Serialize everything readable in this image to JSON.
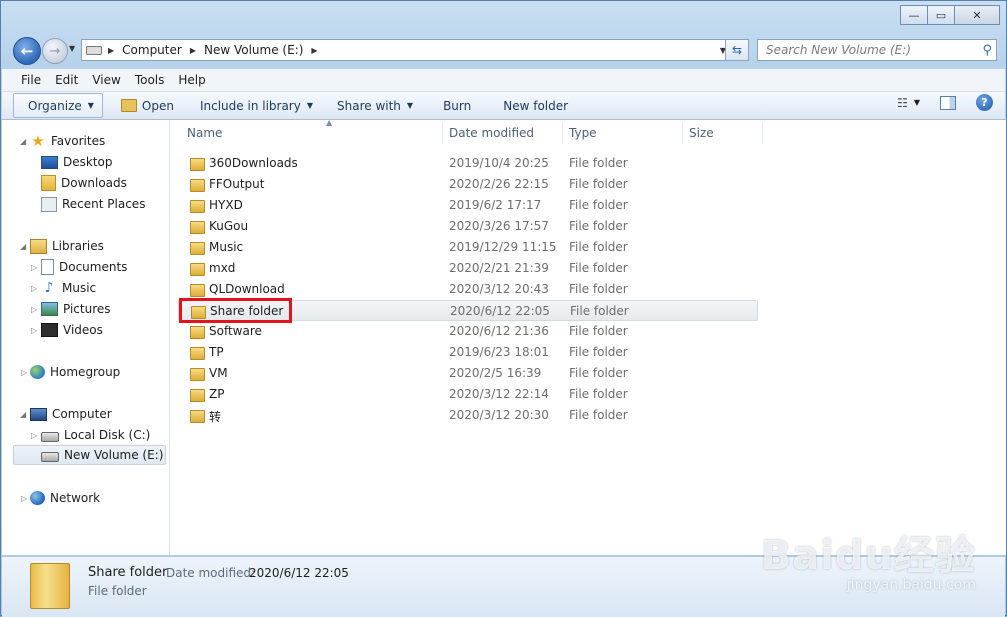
{
  "window": {
    "caption_buttons": [
      "—",
      "▭",
      "✕"
    ]
  },
  "address": {
    "crumbs": [
      "Computer",
      "New Volume (E:)"
    ],
    "search_placeholder": "Search New Volume (E:)"
  },
  "menu": [
    "File",
    "Edit",
    "View",
    "Tools",
    "Help"
  ],
  "toolbar": {
    "organize": "Organize",
    "open": "Open",
    "include_in_library": "Include in library",
    "share_with": "Share with",
    "burn": "Burn",
    "new_folder": "New folder"
  },
  "nav": {
    "favorites": "Favorites",
    "desktop": "Desktop",
    "downloads": "Downloads",
    "recent_places": "Recent Places",
    "libraries": "Libraries",
    "documents": "Documents",
    "music": "Music",
    "pictures": "Pictures",
    "videos": "Videos",
    "homegroup": "Homegroup",
    "computer": "Computer",
    "local_disk": "Local Disk (C:)",
    "new_volume": "New Volume (E:)",
    "network": "Network"
  },
  "columns": {
    "name": "Name",
    "date_modified": "Date modified",
    "type": "Type",
    "size": "Size"
  },
  "files": [
    {
      "name": "360Downloads",
      "date": "2019/10/4 20:25",
      "type": "File folder"
    },
    {
      "name": "FFOutput",
      "date": "2020/2/26 22:15",
      "type": "File folder"
    },
    {
      "name": "HYXD",
      "date": "2019/6/2 17:17",
      "type": "File folder"
    },
    {
      "name": "KuGou",
      "date": "2020/3/26 17:57",
      "type": "File folder"
    },
    {
      "name": "Music",
      "date": "2019/12/29 11:15",
      "type": "File folder"
    },
    {
      "name": "mxd",
      "date": "2020/2/21 21:39",
      "type": "File folder"
    },
    {
      "name": "QLDownload",
      "date": "2020/3/12 20:43",
      "type": "File folder"
    },
    {
      "name": "Share folder",
      "date": "2020/6/12 22:05",
      "type": "File folder",
      "selected": true
    },
    {
      "name": "Software",
      "date": "2020/6/12 21:36",
      "type": "File folder"
    },
    {
      "name": "TP",
      "date": "2019/6/23 18:01",
      "type": "File folder"
    },
    {
      "name": "VM",
      "date": "2020/2/5 16:39",
      "type": "File folder"
    },
    {
      "name": "ZP",
      "date": "2020/3/12 22:14",
      "type": "File folder"
    },
    {
      "name": "转",
      "date": "2020/3/12 20:30",
      "type": "File folder"
    }
  ],
  "details": {
    "name": "Share folder",
    "date_label": "Date modified:",
    "date_value": "2020/6/12 22:05",
    "type": "File folder"
  },
  "watermark": {
    "main": "Baidu经验",
    "sub": "jingyan.baidu.com"
  },
  "colors": {
    "highlight_box": "#e0141a",
    "window_frame": "#b7d3ec"
  }
}
